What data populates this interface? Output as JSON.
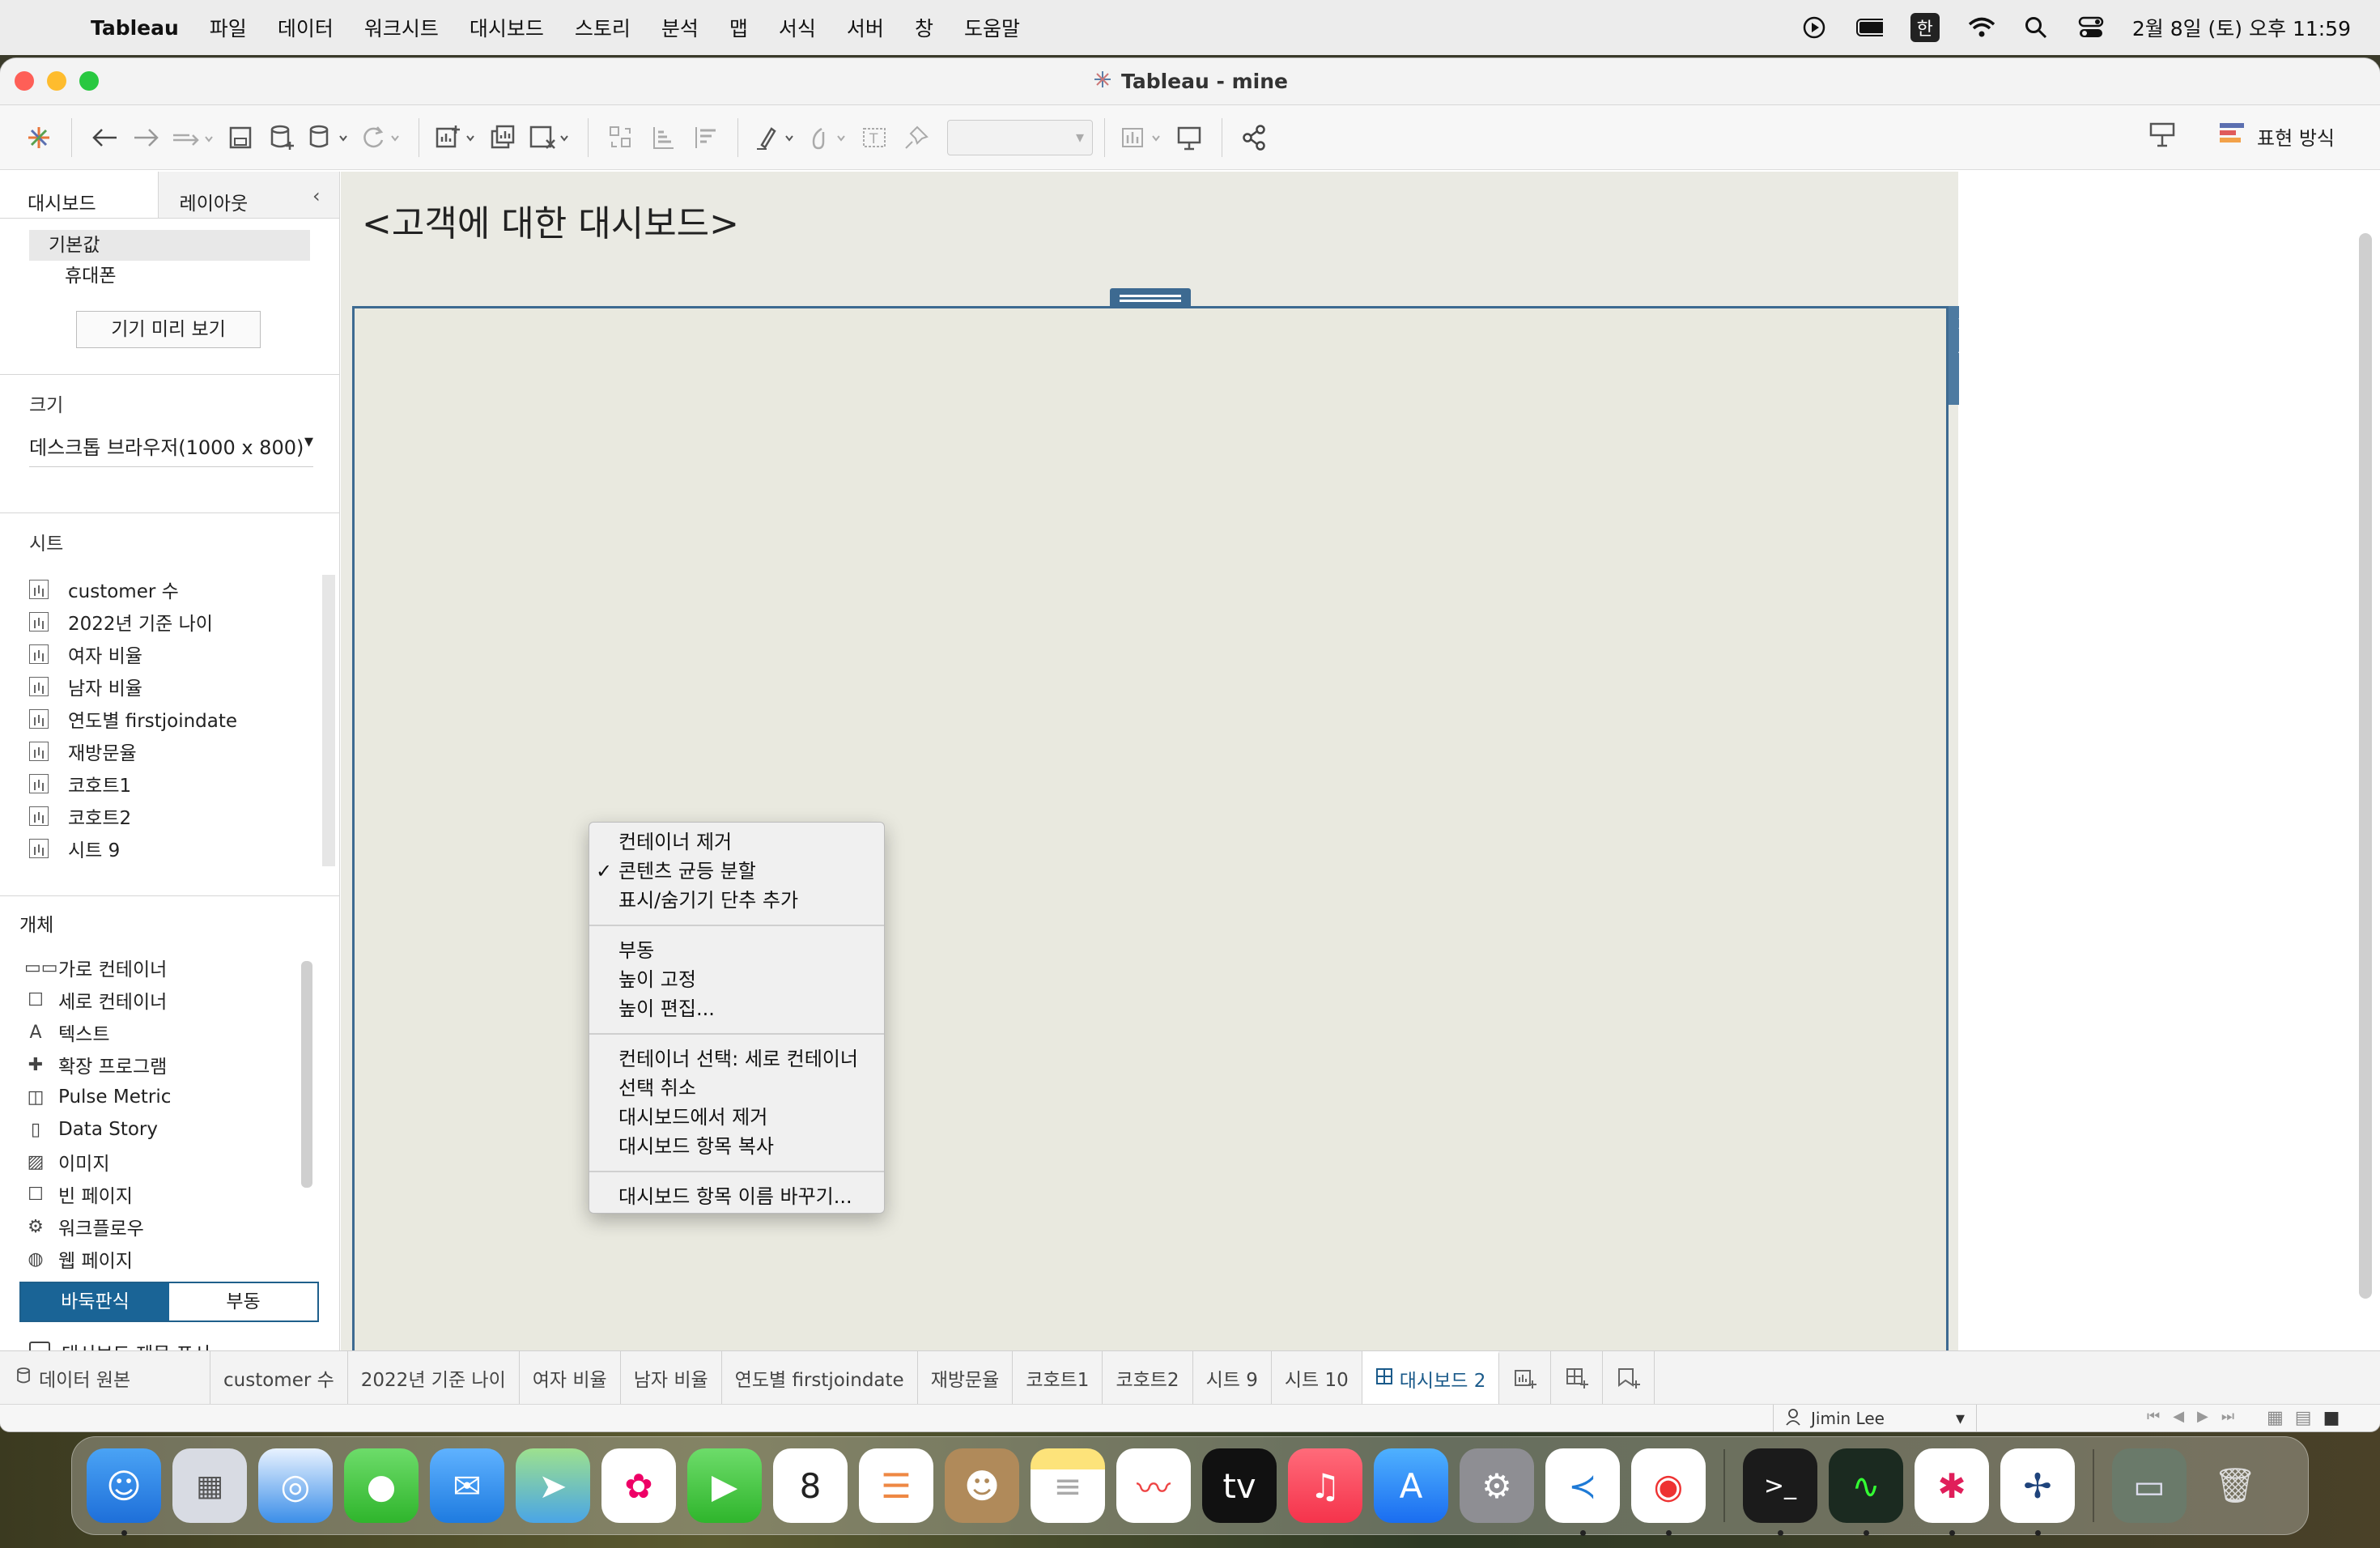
{
  "menubar": {
    "app": "Tableau",
    "items": [
      "파일",
      "데이터",
      "워크시트",
      "대시보드",
      "스토리",
      "분석",
      "맵",
      "서식",
      "서버",
      "창",
      "도움말"
    ],
    "ime": "한",
    "clock": "2월 8일 (토) 오후 11:59"
  },
  "window": {
    "title": "Tableau - mine",
    "show_me": "표현 방식"
  },
  "left": {
    "tab_dashboard": "대시보드",
    "tab_layout": "레이아웃",
    "devices": {
      "default": "기본값",
      "phone": "휴대폰"
    },
    "preview_button": "기기 미리 보기",
    "size_title": "크기",
    "size_value": "데스크톱 브라우저(1000 x 800)",
    "sheets_title": "시트",
    "sheets": [
      "customer 수",
      "2022년 기준 나이",
      "여자 비율",
      "남자 비율",
      "연도별 firstjoindate",
      "재방문율",
      "코호트1",
      "코호트2",
      "시트 9"
    ],
    "objects_title": "개체",
    "objects": [
      {
        "label": "가로 컨테이너",
        "icon": "horizontal-container-icon",
        "glyph": "▭▭"
      },
      {
        "label": "세로 컨테이너",
        "icon": "vertical-container-icon",
        "glyph": "☐"
      },
      {
        "label": "텍스트",
        "icon": "text-icon",
        "glyph": "A"
      },
      {
        "label": "확장 프로그램",
        "icon": "extension-icon",
        "glyph": "✚"
      },
      {
        "label": "Pulse Metric",
        "icon": "pulse-icon",
        "glyph": "◫"
      },
      {
        "label": "Data Story",
        "icon": "book-icon",
        "glyph": "▯"
      },
      {
        "label": "이미지",
        "icon": "image-icon",
        "glyph": "▨"
      },
      {
        "label": "빈 페이지",
        "icon": "blank-icon",
        "glyph": "☐"
      },
      {
        "label": "워크플로우",
        "icon": "workflow-icon",
        "glyph": "⚙"
      },
      {
        "label": "웹 페이지",
        "icon": "globe-icon",
        "glyph": "◍"
      }
    ],
    "tiled": "바둑판식",
    "floating": "부동",
    "show_title": "대시보드 제목 표시"
  },
  "dashboard": {
    "title": "<고객에 대한 대시보드>"
  },
  "context_menu": {
    "group1": [
      "컨테이너 제거",
      "콘텐츠 균등 분할",
      "표시/숨기기 단추 추가"
    ],
    "checked_item": "✓",
    "group2": [
      "부동",
      "높이 고정",
      "높이 편집..."
    ],
    "group3": [
      "컨테이너 선택: 세로 컨테이너",
      "선택 취소",
      "대시보드에서 제거",
      "대시보드 항목 복사"
    ],
    "group4": [
      "대시보드 항목 이름 바꾸기..."
    ]
  },
  "tabs": {
    "data_source": "데이터 원본",
    "items": [
      "customer 수",
      "2022년 기준 나이",
      "여자 비율",
      "남자 비율",
      "연도별 firstjoindate",
      "재방문율",
      "코호트1",
      "코호트2",
      "시트 9",
      "시트 10"
    ],
    "active": "대시보드 2"
  },
  "status": {
    "user": "Jimin Lee"
  },
  "colors": {
    "accent": "#1a6496",
    "container_border": "#3d6a91",
    "canvas_bg": "#e9e9df"
  }
}
